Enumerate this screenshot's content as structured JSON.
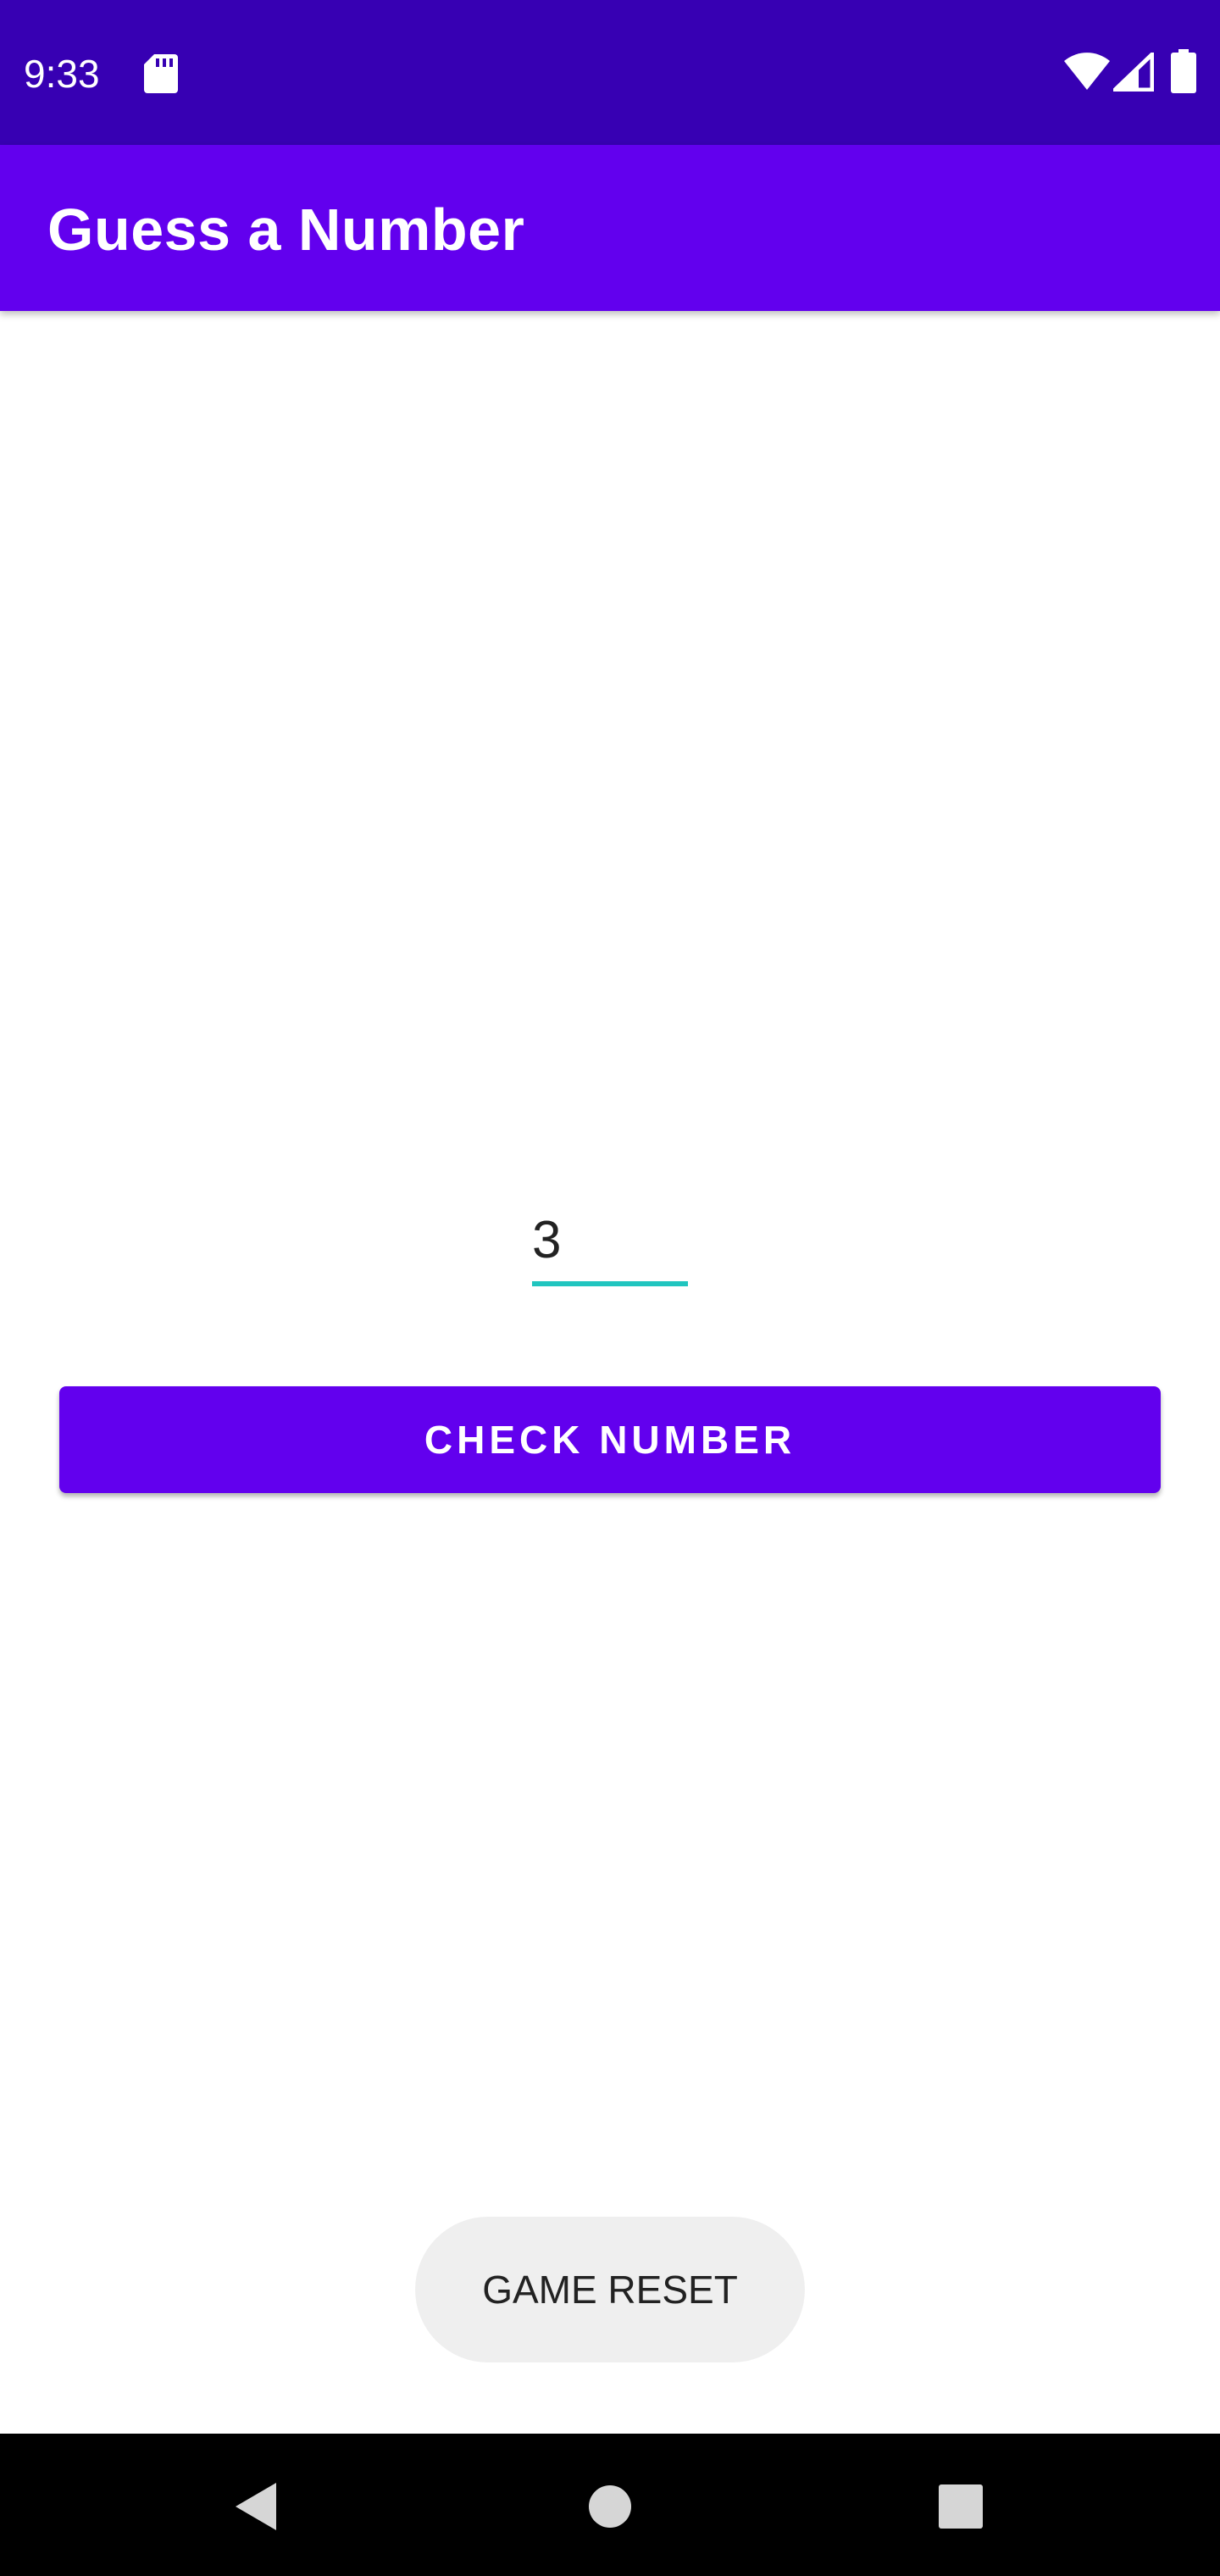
{
  "status_bar": {
    "time": "9:33",
    "icons": [
      "sd-card-icon",
      "wifi-icon",
      "signal-icon",
      "battery-icon"
    ]
  },
  "app_bar": {
    "title": "Guess a Number"
  },
  "main": {
    "number_input": {
      "value": "3"
    },
    "check_button_label": "CHECK NUMBER"
  },
  "toast": {
    "message": "GAME RESET"
  },
  "nav_bar": {
    "icons": [
      "back-icon",
      "home-icon",
      "recents-icon"
    ]
  },
  "colors": {
    "status_bar": "#3700b3",
    "primary": "#6200ee",
    "accent": "#21c5bf",
    "toast_bg": "#efefef",
    "nav_bar": "#000000"
  }
}
